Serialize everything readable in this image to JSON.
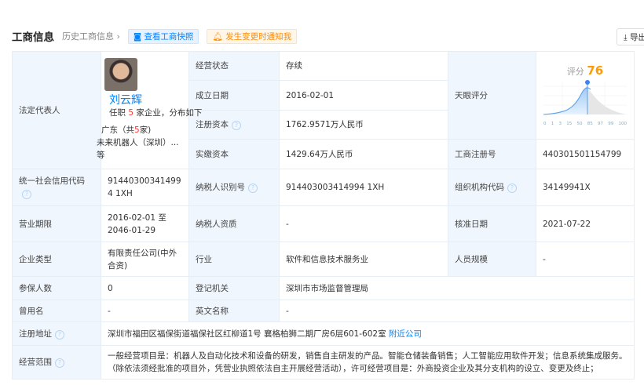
{
  "header": {
    "title": "工商信息",
    "history": "历史工商信息 ›",
    "snapshot": "查看工商快照",
    "notify": "发生变更时通知我",
    "export": "导出"
  },
  "rep": {
    "label": "法定代表人",
    "name": "刘云辉",
    "posts_pre": "任职",
    "posts_num": "5",
    "posts_post": "家企业，分布如下",
    "region_pre": "广东（共",
    "region_num": "5",
    "region_post": "家)",
    "company": "未来机器人（深圳）...",
    "etc": "等"
  },
  "score": {
    "label": "天眼评分",
    "prefix": "评分",
    "value": "76",
    "ticks": [
      "0",
      "1",
      "3",
      "15",
      "50",
      "85",
      "97",
      "99",
      "100"
    ]
  },
  "rows": {
    "status": {
      "label": "经营状态",
      "value": "存续"
    },
    "founded": {
      "label": "成立日期",
      "value": "2016-02-01"
    },
    "regcap": {
      "label": "注册资本",
      "value": "1762.9571万人民币"
    },
    "paidcap": {
      "label": "实缴资本",
      "value": "1429.64万人民币"
    },
    "regno": {
      "label": "工商注册号",
      "value": "440301501154799"
    },
    "credit": {
      "label": "统一社会信用代码",
      "value": "914403003414994 1XH"
    },
    "taxid": {
      "label": "纳税人识别号",
      "value": "914403003414994 1XH"
    },
    "orgcode": {
      "label": "组织机构代码",
      "value": "34149941X"
    },
    "term": {
      "label": "营业期限",
      "value": "2016-02-01 至 2046-01-29"
    },
    "taxq": {
      "label": "纳税人资质",
      "value": "-"
    },
    "approve": {
      "label": "核准日期",
      "value": "2021-07-22"
    },
    "type": {
      "label": "企业类型",
      "value": "有限责任公司(中外合资)"
    },
    "industry": {
      "label": "行业",
      "value": "软件和信息技术服务业"
    },
    "staff": {
      "label": "人员规模",
      "value": "-"
    },
    "insured": {
      "label": "参保人数",
      "value": "0"
    },
    "authority": {
      "label": "登记机关",
      "value": "深圳市市场监督管理局"
    },
    "former": {
      "label": "曾用名",
      "value": "-"
    },
    "english": {
      "label": "英文名称",
      "value": "-"
    },
    "address": {
      "label": "注册地址",
      "value": "深圳市福田区福保街道福保社区红柳道1号 襄格柏狮二期厂房6层601-602室",
      "link": "附近公司"
    },
    "scope": {
      "label": "经营范围",
      "value": "一般经营项目是：机器人及自动化技术和设备的研发，销售自主研发的产品。智能仓储装备销售；人工智能应用软件开发；信息系统集成服务。（除依法须经批准的项目外，凭营业执照依法自主开展经营活动），许可经营项目是：外商投资企业及其分支机构的设立、变更及终止；"
    }
  }
}
